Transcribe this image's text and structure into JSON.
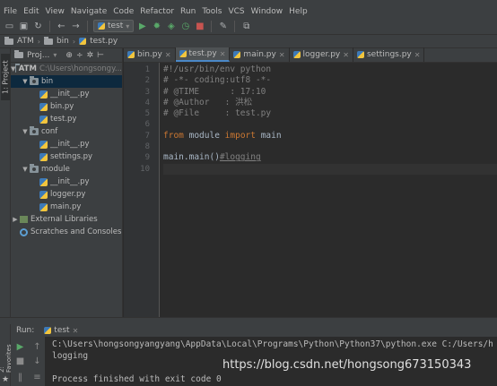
{
  "menubar": {
    "items": [
      "File",
      "Edit",
      "View",
      "Navigate",
      "Code",
      "Refactor",
      "Run",
      "Tools",
      "VCS",
      "Window",
      "Help"
    ]
  },
  "toolbar": {
    "run_config": "test",
    "icons": [
      "open-folder-icon",
      "save-icon",
      "sync-icon",
      "back-arrow-icon",
      "forward-arrow-icon",
      "run-icon",
      "debug-icon",
      "coverage-icon",
      "profile-icon",
      "stop-icon",
      "settings-icon",
      "sdk-icon"
    ]
  },
  "navbar": {
    "crumbs": [
      "ATM",
      "bin",
      "test.py"
    ]
  },
  "left_strip": {
    "tab": "1: Project"
  },
  "project": {
    "header": "Proj...",
    "root": {
      "name": "ATM",
      "path": "C:\\Users\\hongsongy..."
    },
    "tree": [
      {
        "label": "bin",
        "kind": "folder",
        "indent": 1,
        "expanded": true,
        "selected": true
      },
      {
        "label": "__init__.py",
        "kind": "py",
        "indent": 2
      },
      {
        "label": "bin.py",
        "kind": "py",
        "indent": 2
      },
      {
        "label": "test.py",
        "kind": "py",
        "indent": 2
      },
      {
        "label": "conf",
        "kind": "folder",
        "indent": 1,
        "expanded": true
      },
      {
        "label": "__init__.py",
        "kind": "py",
        "indent": 2
      },
      {
        "label": "settings.py",
        "kind": "py",
        "indent": 2
      },
      {
        "label": "module",
        "kind": "folder",
        "indent": 1,
        "expanded": true
      },
      {
        "label": "__init__.py",
        "kind": "py",
        "indent": 2
      },
      {
        "label": "logger.py",
        "kind": "py",
        "indent": 2
      },
      {
        "label": "main.py",
        "kind": "py",
        "indent": 2
      },
      {
        "label": "External Libraries",
        "kind": "lib",
        "indent": 0,
        "expanded": false
      },
      {
        "label": "Scratches and Consoles",
        "kind": "scratch",
        "indent": 0
      }
    ]
  },
  "editor": {
    "tabs": [
      {
        "label": "bin.py",
        "active": false
      },
      {
        "label": "test.py",
        "active": true
      },
      {
        "label": "main.py",
        "active": false
      },
      {
        "label": "logger.py",
        "active": false
      },
      {
        "label": "settings.py",
        "active": false
      }
    ],
    "line_numbers": [
      "1",
      "2",
      "3",
      "4",
      "5",
      "6",
      "7",
      "8",
      "9",
      "10"
    ],
    "lines": {
      "l1": "#!/usr/bin/env python",
      "l2": "# -*- coding:utf8 -*-",
      "l3": "# @TIME      : 17:10",
      "l4": "# @Author   : 洪松",
      "l5": "# @File     : test.py",
      "l7_kw1": "from",
      "l7_mid": " module ",
      "l7_kw2": "import",
      "l7_end": " main",
      "l9_code": "main.main()",
      "l9_comment": "#logging"
    }
  },
  "run_panel": {
    "label": "Run:",
    "tab": "test",
    "console": [
      "C:\\Users\\hongsongyangyang\\AppData\\Local\\Programs\\Python\\Python37\\python.exe C:/Users/h",
      "logging",
      "",
      "Process finished with exit code 0"
    ]
  },
  "fav_strip": {
    "tab": "2: Favorites"
  },
  "watermark": "https://blog.csdn.net/hongsong673150343"
}
